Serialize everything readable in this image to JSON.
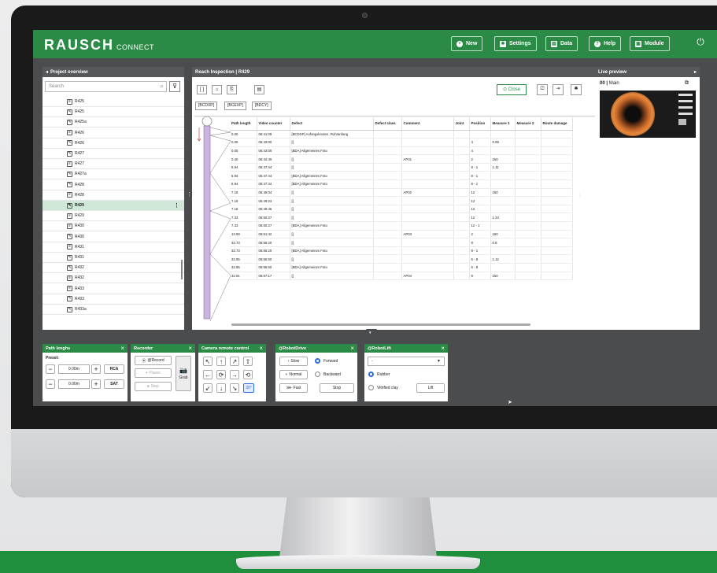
{
  "brand": {
    "name": "RAUSCH",
    "sub": "CONNECT"
  },
  "topbar": {
    "new": "New",
    "settings": "Settings",
    "data": "Data",
    "help": "Help",
    "module": "Module"
  },
  "project": {
    "title": "Project overview",
    "search_placeholder": "Search",
    "items": [
      {
        "label": "R425",
        "type": "doc"
      },
      {
        "label": "R425",
        "type": "pen"
      },
      {
        "label": "R425a",
        "type": "pen"
      },
      {
        "label": "R426",
        "type": "doc"
      },
      {
        "label": "R426",
        "type": "pen"
      },
      {
        "label": "R427",
        "type": "pen"
      },
      {
        "label": "R427",
        "type": "doc"
      },
      {
        "label": "R427a",
        "type": "pen"
      },
      {
        "label": "R428",
        "type": "pen"
      },
      {
        "label": "R428",
        "type": "doc"
      },
      {
        "label": "R429",
        "type": "pen",
        "selected": true
      },
      {
        "label": "R429",
        "type": "doc"
      },
      {
        "label": "R430",
        "type": "doc"
      },
      {
        "label": "R430",
        "type": "pen"
      },
      {
        "label": "R431",
        "type": "doc"
      },
      {
        "label": "R431",
        "type": "pen"
      },
      {
        "label": "R432",
        "type": "pen"
      },
      {
        "label": "R432",
        "type": "doc"
      },
      {
        "label": "R433",
        "type": "doc"
      },
      {
        "label": "R433",
        "type": "pen"
      },
      {
        "label": "R433a",
        "type": "pen"
      }
    ]
  },
  "reach": {
    "title": "Reach Inspection | R429",
    "close": "Close",
    "tags": [
      "[BCDXP]",
      "[BCEXP]",
      "[BDCY]"
    ],
    "columns": [
      "Path length",
      "Video counter",
      "Defect",
      "Defect class",
      "Comment",
      "Joint",
      "Position",
      "Measure 1",
      "Measure 2",
      "Route damage"
    ],
    "rows": [
      [
        "0.00",
        "06:41:09",
        "[BCDXP] Anfangsknoten, Rohranfang",
        "",
        "",
        "",
        "",
        "",
        "",
        ""
      ],
      [
        "0.05",
        "06:43:00",
        "[]",
        "",
        "",
        "",
        "4",
        "0.99",
        "",
        ""
      ],
      [
        "0.05",
        "06:43:00",
        "[BDA] Allgemeines Foto",
        "",
        "",
        "",
        "4",
        "",
        "",
        ""
      ],
      [
        "0.40",
        "06:44:40",
        "[]",
        "",
        "AP01",
        "",
        "2",
        "150",
        "",
        ""
      ],
      [
        "6.94",
        "06:47:44",
        "[]",
        "",
        "",
        "",
        "8 - 1",
        "1.11",
        "",
        ""
      ],
      [
        "6.94",
        "06:47:44",
        "[BDA] Allgemeines Foto",
        "",
        "",
        "",
        "8 - 1",
        "",
        "",
        ""
      ],
      [
        "6.94",
        "06:47:44",
        "[BDA] Allgemeines Foto",
        "",
        "",
        "",
        "8 - 1",
        "",
        "",
        ""
      ],
      [
        "7.18",
        "06:49:04",
        "[]",
        "",
        "AP02",
        "",
        "12",
        "150",
        "",
        ""
      ],
      [
        "7.18",
        "06:49:23",
        "[]",
        "",
        "",
        "",
        "12",
        "",
        "",
        ""
      ],
      [
        "7.18",
        "06:49:45",
        "[]",
        "",
        "",
        "",
        "12",
        "",
        "",
        ""
      ],
      [
        "7.33",
        "06:50:27",
        "[]",
        "",
        "",
        "",
        "12",
        "1.34",
        "",
        ""
      ],
      [
        "7.33",
        "06:50:27",
        "[BDA] Allgemeines Foto",
        "",
        "",
        "",
        "12 - 1",
        "",
        "",
        ""
      ],
      [
        "13.99",
        "06:51:42",
        "[]",
        "",
        "AP03",
        "",
        "2",
        "150",
        "",
        ""
      ],
      [
        "32.73",
        "06:56:20",
        "[]",
        "",
        "",
        "",
        "9",
        "0.8",
        "",
        ""
      ],
      [
        "32.73",
        "06:56:20",
        "[BDA] Allgemeines Foto",
        "",
        "",
        "",
        "9 - 1",
        "",
        "",
        ""
      ],
      [
        "32.85",
        "06:56:50",
        "[]",
        "",
        "",
        "",
        "6 - 8",
        "1.12",
        "",
        ""
      ],
      [
        "32.85",
        "06:56:50",
        "[BDA] Allgemeines Foto",
        "",
        "",
        "",
        "6 - 8",
        "",
        "",
        ""
      ],
      [
        "32.91",
        "06:57:17",
        "[]",
        "",
        "AP04",
        "",
        "9",
        "150",
        "",
        ""
      ]
    ]
  },
  "preview": {
    "title": "Live preview",
    "cam": "00",
    "cam_label": "Main"
  },
  "path": {
    "title": "Path lenghs",
    "preset": "Preset:",
    "v1": "0.00m",
    "v2": "0.00m",
    "b1": "RCA",
    "b2": "SAT"
  },
  "recorder": {
    "title": "Recorder",
    "record": "@Record",
    "pause": "Pause",
    "stop": "Stop",
    "grab": "Grab"
  },
  "camera": {
    "title": "Camera remote control",
    "deg": "30°"
  },
  "drive": {
    "title": "@RobotDrive",
    "slow": "Slow",
    "normal": "Normal",
    "fast": "Fast",
    "forward": "Forward",
    "backward": "Backward",
    "stop": "Stop"
  },
  "lift": {
    "title": "@RobotLift",
    "select": "-",
    "rubber": "Rubber",
    "clay": "Vitrified clay",
    "lift": "Lift"
  }
}
